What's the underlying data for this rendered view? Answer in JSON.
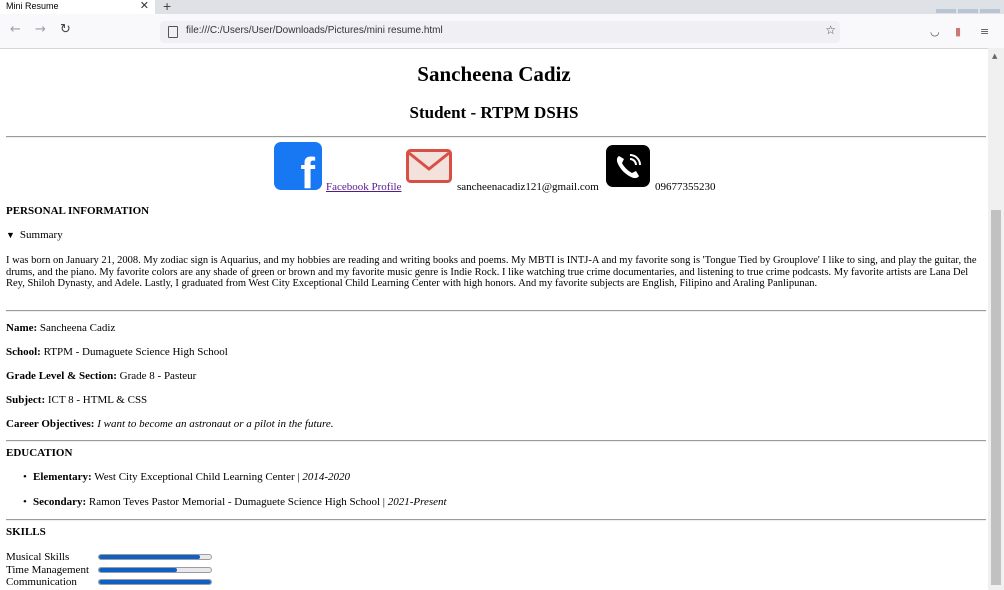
{
  "browser": {
    "tab_title": "Mini Resume",
    "tab_close": "✕",
    "new_tab": "+",
    "url": "file:///C:/Users/User/Downloads/Pictures/mini resume.html"
  },
  "header": {
    "name": "Sancheena Cadiz",
    "subtitle": "Student - RTPM DSHS"
  },
  "contacts": {
    "facebook_icon_letter": "f",
    "facebook_label": "Facebook Profile",
    "email": "sancheenacadiz121@gmail.com",
    "phone": "09677355230",
    "icons": [
      "facebook-icon",
      "mail-icon",
      "phone-icon"
    ]
  },
  "personal": {
    "heading": "PERSONAL INFORMATION",
    "summary_label": "Summary",
    "summary_marker": "▼",
    "paragraph": "I was born on January 21, 2008. My zodiac sign is Aquarius, and my hobbies are reading and writing books and poems. My MBTI is INTJ-A and my favorite song is 'Tongue Tied by Grouplove' I like to sing, and play the guitar, the drums, and the piano. My favorite colors are any shade of green or brown and my favorite music genre is Indie Rock. I like watching true crime documentaries, and listening to true crime podcasts. My favorite artists are Lana Del Rey, Shiloh Dynasty, and Adele. Lastly, I graduated from West City Exceptional Child Learning Center with high honors. And my favorite subjects are English, Filipino and Araling Panlipunan.",
    "fields": [
      {
        "label": "Name:",
        "value": "Sancheena Cadiz"
      },
      {
        "label": "School:",
        "value": "RTPM - Dumaguete Science High School"
      },
      {
        "label": "Grade Level & Section:",
        "value": "Grade 8 - Pasteur"
      },
      {
        "label": "Subject:",
        "value": "ICT 8 - HTML & CSS"
      },
      {
        "label": "Career Objectives:",
        "value": "I want to become an astronaut or a pilot in the future."
      }
    ]
  },
  "education": {
    "heading": "EDUCATION",
    "items": [
      {
        "level": "Elementary:",
        "school": "West City Exceptional Child Learning Center",
        "sep": "|",
        "years": "2014-2020"
      },
      {
        "level": "Secondary:",
        "school": "Ramon Teves Pastor Memorial - Dumaguete Science High School",
        "sep": "|",
        "years": "2021-Present"
      }
    ]
  },
  "skills": {
    "heading": "SKILLS",
    "items": [
      {
        "label": "Musical Skills",
        "level": 0.9
      },
      {
        "label": "Time Management",
        "level": 0.7
      },
      {
        "label": "Communication",
        "level": 1.0
      }
    ],
    "bar_color": "#0f5fc4"
  }
}
